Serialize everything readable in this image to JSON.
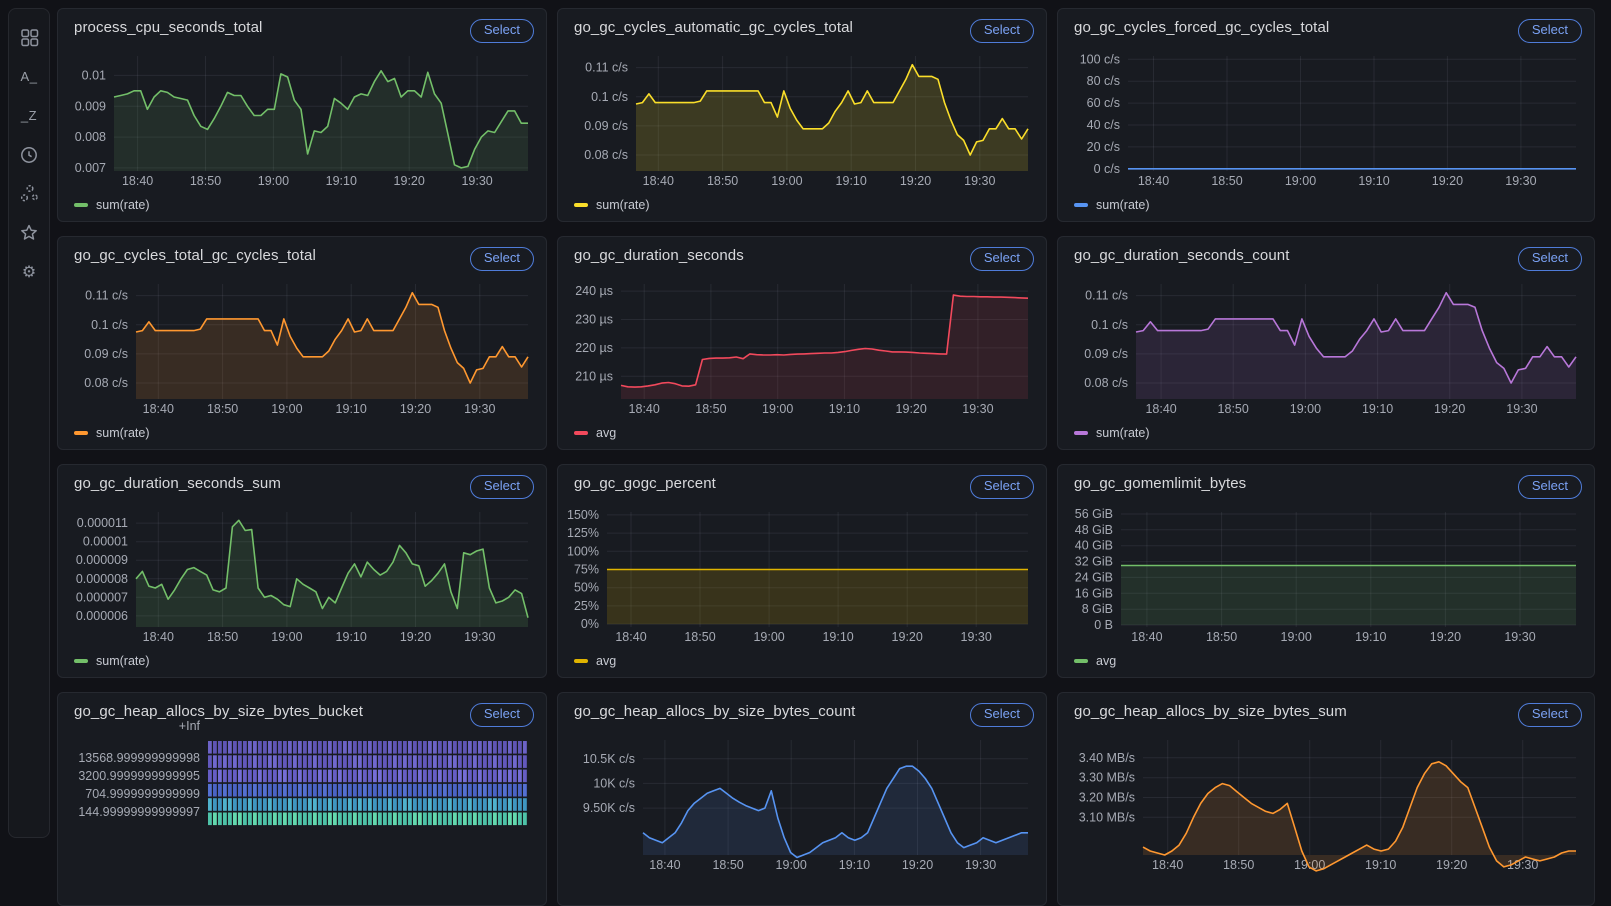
{
  "sidebar": {
    "icons": [
      {
        "name": "apps-grid"
      },
      {
        "name": "sort-prefix",
        "label": "A_"
      },
      {
        "name": "sort-suffix",
        "label": "_Z"
      },
      {
        "name": "clock"
      },
      {
        "name": "cluster"
      },
      {
        "name": "star"
      },
      {
        "name": "gear"
      }
    ]
  },
  "time_axis": {
    "start": "18:37",
    "end": "19:37",
    "ticks": [
      {
        "frac": 0.057,
        "label": "18:40"
      },
      {
        "frac": 0.221,
        "label": "18:50"
      },
      {
        "frac": 0.385,
        "label": "19:00"
      },
      {
        "frac": 0.549,
        "label": "19:10"
      },
      {
        "frac": 0.713,
        "label": "19:20"
      },
      {
        "frac": 0.877,
        "label": "19:30"
      }
    ]
  },
  "panels": [
    {
      "title": "process_cpu_seconds_total",
      "select_label": "Select",
      "legend": "sum(rate)",
      "color": "#73BF69",
      "fill_opacity": 0.12,
      "chart_data": {
        "type": "area",
        "unit": "",
        "ylim": [
          0.0069,
          0.01063
        ],
        "yticks": [
          {
            "v": 0.01,
            "label": "0.01"
          },
          {
            "v": 0.009,
            "label": "0.009"
          },
          {
            "v": 0.008,
            "label": "0.008"
          },
          {
            "v": 0.007,
            "label": "0.007"
          }
        ],
        "values": [
          0.0093,
          0.00935,
          0.0094,
          0.0095,
          0.0095,
          0.0089,
          0.0093,
          0.0095,
          0.00945,
          0.0093,
          0.00925,
          0.0092,
          0.0087,
          0.00835,
          0.00825,
          0.0086,
          0.009,
          0.00945,
          0.00935,
          0.00935,
          0.009,
          0.0087,
          0.0087,
          0.0089,
          0.0089,
          0.01005,
          0.00995,
          0.0092,
          0.0089,
          0.00745,
          0.0082,
          0.00815,
          0.00835,
          0.00925,
          0.0091,
          0.0089,
          0.0093,
          0.0094,
          0.00935,
          0.0098,
          0.01015,
          0.0098,
          0.0099,
          0.0093,
          0.0095,
          0.0095,
          0.0093,
          0.0101,
          0.0094,
          0.0091,
          0.0081,
          0.0071,
          0.007,
          0.00705,
          0.0076,
          0.008,
          0.0082,
          0.00815,
          0.0085,
          0.00885,
          0.00885,
          0.00845,
          0.00845
        ]
      }
    },
    {
      "title": "go_gc_cycles_automatic_gc_cycles_total",
      "select_label": "Select",
      "legend": "sum(rate)",
      "color": "#FADE2A",
      "fill_opacity": 0.16,
      "chart_data": {
        "type": "area",
        "unit": "c/s",
        "ylim": [
          0.0745,
          0.114
        ],
        "yticks": [
          {
            "v": 0.11,
            "label": "0.11 c/s"
          },
          {
            "v": 0.1,
            "label": "0.1 c/s"
          },
          {
            "v": 0.09,
            "label": "0.09 c/s"
          },
          {
            "v": 0.08,
            "label": "0.08 c/s"
          }
        ],
        "values": [
          0.0975,
          0.098,
          0.101,
          0.098,
          0.098,
          0.098,
          0.098,
          0.098,
          0.098,
          0.098,
          0.0985,
          0.102,
          0.102,
          0.102,
          0.102,
          0.102,
          0.102,
          0.102,
          0.102,
          0.102,
          0.098,
          0.098,
          0.093,
          0.102,
          0.096,
          0.092,
          0.089,
          0.089,
          0.089,
          0.089,
          0.091,
          0.095,
          0.098,
          0.102,
          0.0975,
          0.098,
          0.102,
          0.098,
          0.098,
          0.098,
          0.098,
          0.102,
          0.106,
          0.111,
          0.107,
          0.107,
          0.107,
          0.106,
          0.098,
          0.092,
          0.087,
          0.085,
          0.08,
          0.0845,
          0.085,
          0.089,
          0.089,
          0.0925,
          0.089,
          0.089,
          0.0855,
          0.089
        ]
      }
    },
    {
      "title": "go_gc_cycles_forced_gc_cycles_total",
      "select_label": "Select",
      "legend": "sum(rate)",
      "color": "#5794F2",
      "fill_opacity": 0,
      "chart_data": {
        "type": "area",
        "unit": "c/s",
        "ylim": [
          -2,
          103
        ],
        "yticks": [
          {
            "v": 100,
            "label": "100 c/s"
          },
          {
            "v": 80,
            "label": "80 c/s"
          },
          {
            "v": 60,
            "label": "60 c/s"
          },
          {
            "v": 40,
            "label": "40 c/s"
          },
          {
            "v": 20,
            "label": "20 c/s"
          },
          {
            "v": 0,
            "label": "0 c/s"
          }
        ],
        "values": [
          0,
          0
        ]
      }
    },
    {
      "title": "go_gc_cycles_total_gc_cycles_total",
      "select_label": "Select",
      "legend": "sum(rate)",
      "color": "#FF9830",
      "fill_opacity": 0.14,
      "chart_data": {
        "type": "area",
        "unit": "c/s",
        "ylim": [
          0.0745,
          0.114
        ],
        "yticks": [
          {
            "v": 0.11,
            "label": "0.11 c/s"
          },
          {
            "v": 0.1,
            "label": "0.1 c/s"
          },
          {
            "v": 0.09,
            "label": "0.09 c/s"
          },
          {
            "v": 0.08,
            "label": "0.08 c/s"
          }
        ],
        "values": [
          0.0975,
          0.098,
          0.101,
          0.098,
          0.098,
          0.098,
          0.098,
          0.098,
          0.098,
          0.098,
          0.0985,
          0.102,
          0.102,
          0.102,
          0.102,
          0.102,
          0.102,
          0.102,
          0.102,
          0.102,
          0.098,
          0.098,
          0.093,
          0.102,
          0.096,
          0.092,
          0.089,
          0.089,
          0.089,
          0.089,
          0.091,
          0.095,
          0.098,
          0.102,
          0.0975,
          0.098,
          0.102,
          0.098,
          0.098,
          0.098,
          0.098,
          0.102,
          0.106,
          0.111,
          0.107,
          0.107,
          0.107,
          0.106,
          0.098,
          0.092,
          0.087,
          0.085,
          0.08,
          0.0845,
          0.085,
          0.089,
          0.089,
          0.0925,
          0.089,
          0.089,
          0.0855,
          0.089
        ]
      }
    },
    {
      "title": "go_gc_duration_seconds",
      "select_label": "Select",
      "legend": "avg",
      "color": "#F2495C",
      "fill_opacity": 0.12,
      "chart_data": {
        "type": "area",
        "unit": "µs",
        "ylim": [
          202,
          242.5
        ],
        "yticks": [
          {
            "v": 240,
            "label": "240 µs"
          },
          {
            "v": 230,
            "label": "230 µs"
          },
          {
            "v": 220,
            "label": "220 µs"
          },
          {
            "v": 210,
            "label": "210 µs"
          }
        ],
        "values": [
          206.8,
          206.3,
          206.2,
          206.3,
          206.6,
          207,
          207.6,
          207.8,
          207.4,
          206.6,
          206.5,
          207,
          215.9,
          216.3,
          216.4,
          216.4,
          216.5,
          216.8,
          216.2,
          217.9,
          217.6,
          217.5,
          217.5,
          217.6,
          217.5,
          217.7,
          217.8,
          217.9,
          218,
          218.1,
          218.2,
          218.2,
          218.4,
          218.7,
          219.1,
          219.5,
          219.8,
          219.6,
          219.2,
          218.9,
          218.6,
          218.6,
          218.5,
          218.4,
          218.2,
          218.1,
          218,
          217.9,
          217.8,
          238.6,
          238.2,
          238.1,
          238.1,
          238,
          238,
          237.9,
          237.9,
          237.8,
          237.7,
          237.6,
          237.5
        ]
      }
    },
    {
      "title": "go_gc_duration_seconds_count",
      "select_label": "Select",
      "legend": "sum(rate)",
      "color": "#B877D9",
      "fill_opacity": 0.12,
      "chart_data": {
        "type": "area",
        "unit": "c/s",
        "ylim": [
          0.0745,
          0.114
        ],
        "yticks": [
          {
            "v": 0.11,
            "label": "0.11 c/s"
          },
          {
            "v": 0.1,
            "label": "0.1 c/s"
          },
          {
            "v": 0.09,
            "label": "0.09 c/s"
          },
          {
            "v": 0.08,
            "label": "0.08 c/s"
          }
        ],
        "values": [
          0.0975,
          0.098,
          0.101,
          0.098,
          0.098,
          0.098,
          0.098,
          0.098,
          0.098,
          0.098,
          0.0985,
          0.102,
          0.102,
          0.102,
          0.102,
          0.102,
          0.102,
          0.102,
          0.102,
          0.102,
          0.098,
          0.098,
          0.093,
          0.102,
          0.096,
          0.092,
          0.089,
          0.089,
          0.089,
          0.089,
          0.091,
          0.095,
          0.098,
          0.102,
          0.0975,
          0.098,
          0.102,
          0.098,
          0.098,
          0.098,
          0.098,
          0.102,
          0.106,
          0.111,
          0.107,
          0.107,
          0.107,
          0.106,
          0.098,
          0.092,
          0.087,
          0.085,
          0.08,
          0.0845,
          0.085,
          0.089,
          0.089,
          0.0925,
          0.089,
          0.089,
          0.0855,
          0.089
        ]
      }
    },
    {
      "title": "go_gc_duration_seconds_sum",
      "select_label": "Select",
      "legend": "sum(rate)",
      "color": "#73BF69",
      "fill_opacity": 0.14,
      "chart_data": {
        "type": "area",
        "unit": "",
        "ylim": [
          5.4e-06,
          1.16e-05
        ],
        "yticks": [
          {
            "v": 1.1e-05,
            "label": "0.000011"
          },
          {
            "v": 1e-05,
            "label": "0.00001"
          },
          {
            "v": 9e-06,
            "label": "0.000009"
          },
          {
            "v": 8e-06,
            "label": "0.000008"
          },
          {
            "v": 7e-06,
            "label": "0.000007"
          },
          {
            "v": 6e-06,
            "label": "0.000006"
          }
        ],
        "values": [
          8e-06,
          8.4e-06,
          7.6e-06,
          7.5e-06,
          7.7e-06,
          6.9e-06,
          7.4e-06,
          8e-06,
          8.5e-06,
          8.6e-06,
          8.4e-06,
          8.2e-06,
          7.4e-06,
          7.3e-06,
          7.5e-06,
          1.08e-05,
          1.115e-05,
          1.06e-05,
          1.065e-05,
          7.5e-06,
          7e-06,
          7.1e-06,
          6.9e-06,
          6.6e-06,
          6.5e-06,
          8e-06,
          7.7e-06,
          7.5e-06,
          7.3e-06,
          6.4e-06,
          7e-06,
          6.7e-06,
          7.5e-06,
          8.3e-06,
          8.8e-06,
          8.1e-06,
          8.9e-06,
          8.5e-06,
          8.2e-06,
          8.4e-06,
          8.9e-06,
          9.8e-06,
          9.4e-06,
          8.8e-06,
          8.7e-06,
          7.6e-06,
          7.9e-06,
          8.3e-06,
          8.8e-06,
          7.3e-06,
          6.4e-06,
          9.4e-06,
          9.3e-06,
          9.5e-06,
          9.6e-06,
          7.5e-06,
          6.7e-06,
          6.8e-06,
          7e-06,
          7.4e-06,
          7.2e-06,
          5.9e-06
        ]
      }
    },
    {
      "title": "go_gc_gogc_percent",
      "select_label": "Select",
      "legend": "avg",
      "color": "#E0B400",
      "fill_opacity": 0.16,
      "chart_data": {
        "type": "area",
        "unit": "%",
        "ylim": [
          -4,
          154
        ],
        "yticks": [
          {
            "v": 150,
            "label": "150%"
          },
          {
            "v": 125,
            "label": "125%"
          },
          {
            "v": 100,
            "label": "100%"
          },
          {
            "v": 75,
            "label": "75%"
          },
          {
            "v": 50,
            "label": "50%"
          },
          {
            "v": 25,
            "label": "25%"
          },
          {
            "v": 0,
            "label": "0%"
          }
        ],
        "values": [
          75,
          75
        ]
      }
    },
    {
      "title": "go_gc_gomemlimit_bytes",
      "select_label": "Select",
      "legend": "avg",
      "color": "#73BF69",
      "fill_opacity": 0.13,
      "chart_data": {
        "type": "area",
        "unit": "GiB",
        "ylim": [
          -1,
          57
        ],
        "yticks": [
          {
            "v": 56,
            "label": "56 GiB"
          },
          {
            "v": 48,
            "label": "48 GiB"
          },
          {
            "v": 40,
            "label": "40 GiB"
          },
          {
            "v": 32,
            "label": "32 GiB"
          },
          {
            "v": 24,
            "label": "24 GiB"
          },
          {
            "v": 16,
            "label": "16 GiB"
          },
          {
            "v": 8,
            "label": "8 GiB"
          },
          {
            "v": 0,
            "label": "0 B"
          }
        ],
        "values": [
          30,
          30
        ]
      }
    },
    {
      "title": "go_gc_heap_allocs_by_size_bytes_bucket",
      "select_label": "Select",
      "legend": null,
      "color": "#6c62c6",
      "fill_opacity": 0,
      "chart_data": {
        "type": "heatmap",
        "ylabels": [
          "+Inf",
          "13568.999999999998",
          "3200.9999999999995",
          "704.9999999999999",
          "144.99999999999997"
        ],
        "rows": [
          {
            "base": "#5f55b5",
            "alt": "#6c62c6"
          },
          {
            "base": "#6258bc",
            "alt": "#7068ce"
          },
          {
            "base": "#665dc4",
            "alt": "#756dd6"
          },
          {
            "base": "#4a63c5",
            "alt": "#5470d2"
          },
          {
            "base": "#3f96c0",
            "alt": "#4fb2cc"
          },
          {
            "base": "#4ec3a8",
            "alt": "#63d9ae"
          }
        ]
      }
    },
    {
      "title": "go_gc_heap_allocs_by_size_bytes_count",
      "select_label": "Select",
      "legend": null,
      "color": "#5794F2",
      "fill_opacity": 0.12,
      "chart_data": {
        "type": "area",
        "unit": "K c/s",
        "ylim": [
          8.55,
          10.88
        ],
        "yticks": [
          {
            "v": 10.5,
            "label": "10.5K c/s"
          },
          {
            "v": 10,
            "label": "10K c/s"
          },
          {
            "v": 9.5,
            "label": "9.50K c/s"
          }
        ],
        "values": [
          9,
          8.9,
          8.85,
          8.8,
          8.9,
          9,
          9.2,
          9.45,
          9.6,
          9.7,
          9.8,
          9.85,
          9.9,
          9.8,
          9.7,
          9.62,
          9.55,
          9.5,
          9.45,
          9.5,
          9.85,
          9.3,
          8.9,
          8.6,
          8.5,
          8.55,
          8.6,
          8.7,
          8.8,
          8.85,
          8.9,
          9,
          8.9,
          8.85,
          8.9,
          9,
          9.3,
          9.6,
          9.9,
          10.1,
          10.3,
          10.35,
          10.35,
          10.25,
          10.1,
          9.9,
          9.6,
          9.3,
          9,
          8.8,
          8.7,
          8.75,
          8.8,
          8.9,
          8.85,
          8.8,
          8.85,
          8.9,
          8.95,
          9,
          9
        ]
      }
    },
    {
      "title": "go_gc_heap_allocs_by_size_bytes_sum",
      "select_label": "Select",
      "legend": null,
      "color": "#FF9830",
      "fill_opacity": 0.14,
      "chart_data": {
        "type": "area",
        "unit": "MB/s",
        "ylim": [
          2.91,
          3.49
        ],
        "yticks": [
          {
            "v": 3.4,
            "label": "3.40 MB/s"
          },
          {
            "v": 3.3,
            "label": "3.30 MB/s"
          },
          {
            "v": 3.2,
            "label": "3.20 MB/s"
          },
          {
            "v": 3.1,
            "label": "3.10 MB/s"
          }
        ],
        "values": [
          2.95,
          2.93,
          2.92,
          2.91,
          2.93,
          2.96,
          3.02,
          3.1,
          3.17,
          3.22,
          3.25,
          3.27,
          3.26,
          3.23,
          3.2,
          3.17,
          3.15,
          3.13,
          3.12,
          3.14,
          3.17,
          3.05,
          2.93,
          2.85,
          2.83,
          2.84,
          2.86,
          2.88,
          2.9,
          2.92,
          2.94,
          2.96,
          2.94,
          2.93,
          2.94,
          2.98,
          3.05,
          3.15,
          3.25,
          3.32,
          3.37,
          3.38,
          3.36,
          3.32,
          3.28,
          3.25,
          3.15,
          3.05,
          2.95,
          2.88,
          2.85,
          2.86,
          2.88,
          2.9,
          2.89,
          2.88,
          2.89,
          2.9,
          2.92,
          2.93,
          2.93
        ]
      }
    }
  ]
}
